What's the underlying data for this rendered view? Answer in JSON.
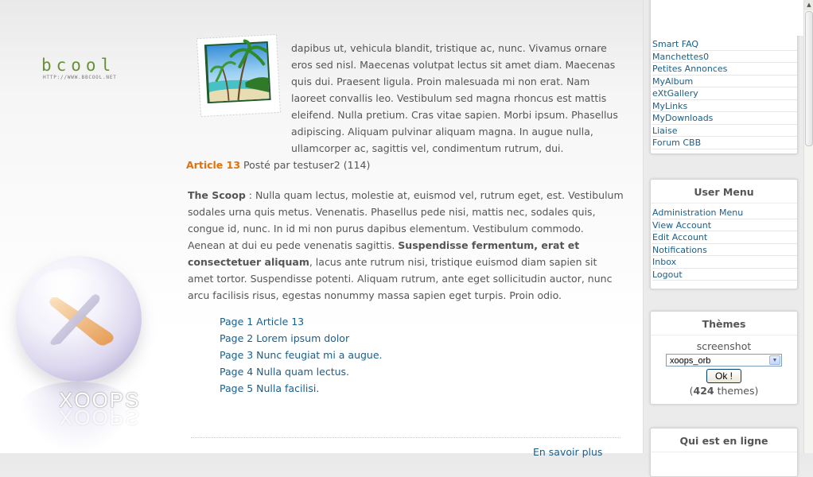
{
  "logo": {
    "text": "bcool",
    "url": "HTTP://WWW.BBCOOL.NET"
  },
  "brand": {
    "text": "XOOPS"
  },
  "intro_text": "dapibus ut, vehicula blandit, tristique ac, nunc. Vivamus ornare eros sed nisl. Maecenas volutpat lectus sit amet diam. Maecenas quis dui. Praesent ligula. Proin malesuada mi non erat. Nam laoreet convallis leo. Vestibulum sed magna rhoncus est mattis eleifend. Nulla pretium. Cras vitae sapien. Morbi ipsum. Phasellus adipiscing. Aliquam pulvinar aliquam magna. In augue nulla, ullamcorper ac, sagittis vel, condimentum rutrum, dui.",
  "article": {
    "title": "Article 13",
    "posted_by": " Posté par testuser2 (114)"
  },
  "scoop": {
    "label": "The Scoop",
    "text1": " : Nulla quam lectus, molestie at, euismod vel, rutrum eget, est. Vestibulum sodales urna quis metus. Venenatis. Phasellus pede nisi, mattis nec, sodales quis, congue id, nunc. In id mi non purus dapibus elementum. Vestibulum commodo. Aenean at dui eu pede venenatis sagittis. ",
    "bold": "Suspendisse fermentum, erat et consectetuer aliquam",
    "text2": ", lacus ante rutrum nisi, tristique euismod diam sapien sit amet tortor. Suspendisse potenti. Aliquam rutrum, ante eget sollicitudin auctor, nunc arcu facilisis risus, egestas nonummy massa sapien eget turpis. Proin odio."
  },
  "pages": [
    "Page 1 Article 13",
    "Page 2 Lorem ipsum dolor",
    "Page 3 Nunc feugiat mi a augue.",
    "Page 4 Nulla quam lectus.",
    "Page 5 Nulla facilisi."
  ],
  "read_more": "En savoir plus",
  "modules_menu": [
    "Smart FAQ",
    "Manchettes0",
    "Petites Annonces",
    "MyAlbum",
    "eXtGallery",
    "MyLinks",
    "MyDownloads",
    "Liaise",
    "Forum CBB"
  ],
  "user_menu": {
    "title": "User Menu",
    "items": [
      "Administration Menu",
      "View Account",
      "Edit Account",
      "Notifications",
      "Inbox",
      "Logout"
    ]
  },
  "themes": {
    "title": "Thèmes",
    "screenshot_label": "screenshot",
    "selected": "xoops_orb",
    "ok_label": "Ok !",
    "count_open": "(",
    "count": "424",
    "count_suffix": " themes)"
  },
  "online": {
    "title": "Qui est en ligne"
  }
}
